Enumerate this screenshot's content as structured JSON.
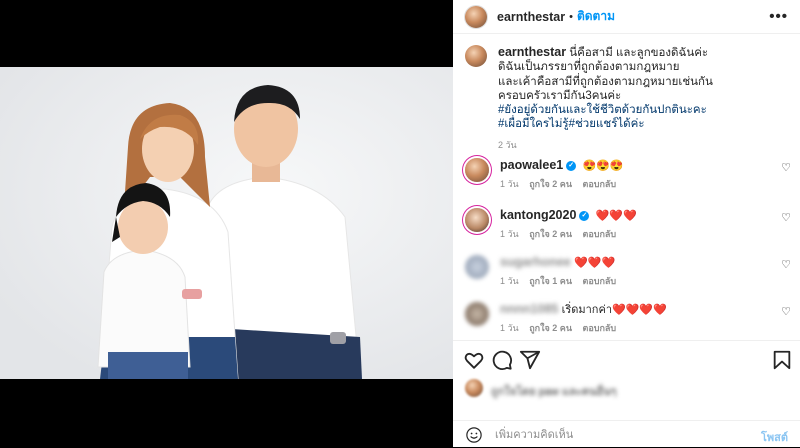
{
  "post": {
    "username": "earnthestar",
    "follow_label": "ติดตาม",
    "more_label": "•••"
  },
  "caption": {
    "username": "earnthestar",
    "lines": [
      "นี่คือสามี และลูกของดิฉันค่ะ",
      "ดิฉันเป็นภรรยาที่ถูกต้องตามกฎหมาย",
      "และเค้าคือสามีที่ถูกต้องตามกฎหมายเช่นกัน",
      "ครอบครัวเรามีกัน3คนค่ะ"
    ],
    "hashtags": [
      "#ยังอยู่ด้วยกันและใช้ชีวิตด้วยกันปกตินะคะ",
      "#เผื่อมีใครไม่รู้#ช่วยแชร์ได้ค่ะ"
    ],
    "time": "2 วัน"
  },
  "comments": [
    {
      "username": "paowalee1",
      "verified": true,
      "text": "😍😍😍",
      "time": "1 วัน",
      "likes": "ถูกใจ 2 คน",
      "reply": "ตอบกลับ",
      "blurred": false
    },
    {
      "username": "kantong2020",
      "verified": true,
      "text": "❤️❤️❤️",
      "time": "1 วัน",
      "likes": "ถูกใจ 2 คน",
      "reply": "ตอบกลับ",
      "blurred": false
    },
    {
      "username": "sugarhonee",
      "verified": false,
      "text": "❤️❤️❤️",
      "time": "1 วัน",
      "likes": "ถูกใจ 1 คน",
      "reply": "ตอบกลับ",
      "blurred": true
    },
    {
      "username": "nnnn1085",
      "verified": false,
      "text": "เริ่ดมากค่า❤️❤️❤️❤️",
      "time": "1 วัน",
      "likes": "ถูกใจ 2 คน",
      "reply": "ตอบกลับ",
      "blurred": true
    }
  ],
  "actions": {
    "like_icon": "heart-icon",
    "comment_icon": "comment-icon",
    "share_icon": "share-icon",
    "save_icon": "bookmark-icon"
  },
  "likes_text": "ถูกใจโดย paw และคนอื่นๆ",
  "add_comment": {
    "placeholder": "เพิ่มความคิดเห็น",
    "post_label": "โพสต์"
  },
  "colors": {
    "link_blue": "#0095f6",
    "hashtag_blue": "#00376b",
    "muted": "#8e8e8e",
    "heart_red": "#e0245e"
  }
}
